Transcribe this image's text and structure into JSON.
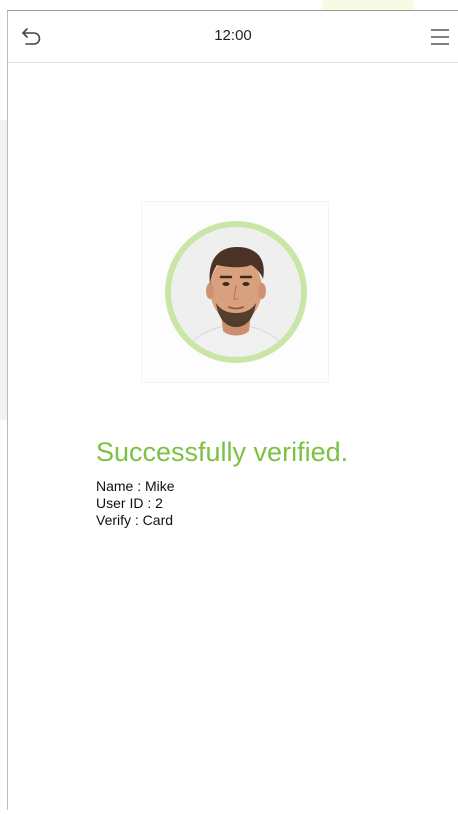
{
  "status_bar": {
    "time": "12:00",
    "back_icon": "back-arrow-icon",
    "menu_icon": "hamburger-menu-icon"
  },
  "verification": {
    "photo": "user-face-photo",
    "message": "Successfully verified.",
    "name_line": "Name : Mike",
    "user_id_line": "User ID : 2",
    "verify_line": "Verify : Card"
  },
  "colors": {
    "success_green": "#7cc142",
    "avatar_ring": "#c9e6a6",
    "divider": "#dedede"
  }
}
